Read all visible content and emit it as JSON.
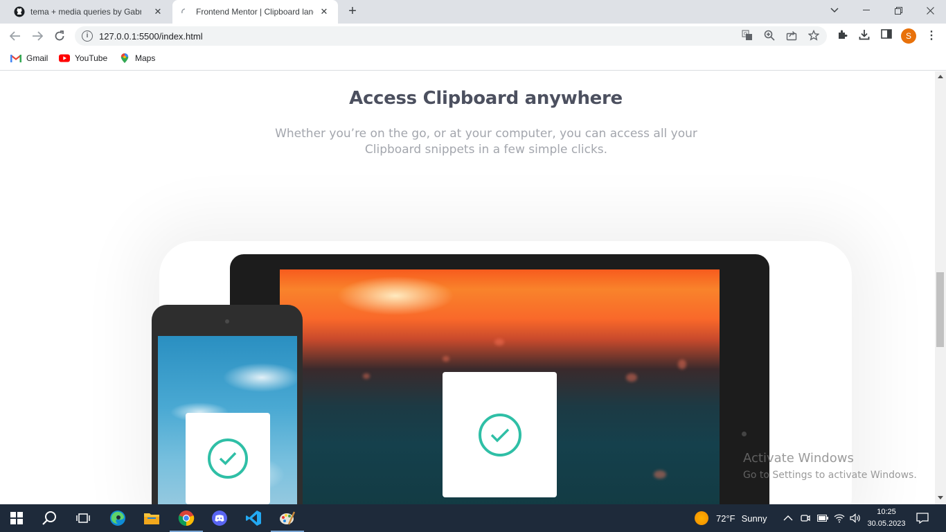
{
  "browser": {
    "tabs": [
      {
        "title": "tema + media queries by Gabriel",
        "close": "✕"
      },
      {
        "title": "Frontend Mentor | Clipboard landing",
        "close": "✕"
      }
    ],
    "new_tab": "+",
    "url": "127.0.0.1:5500/index.html",
    "profile_initial": "S",
    "bookmarks": [
      {
        "label": "Gmail"
      },
      {
        "label": "YouTube"
      },
      {
        "label": "Maps"
      }
    ]
  },
  "page": {
    "headline": "Access Clipboard anywhere",
    "subtext": "Whether you’re on the go, or at your computer, you can access all your Clipboard snippets in a few simple clicks.",
    "accent_color": "#2fbfa6"
  },
  "watermark": {
    "title": "Activate Windows",
    "subtitle": "Go to Settings to activate Windows."
  },
  "taskbar": {
    "weather_temp": "72°F",
    "weather_text": "Sunny",
    "time": "10:25",
    "date": "30.05.2023"
  }
}
